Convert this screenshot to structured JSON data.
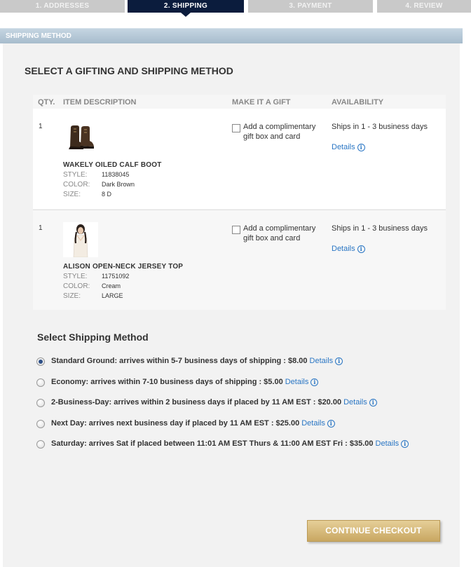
{
  "steps": [
    {
      "label": "1. ADDRESSES"
    },
    {
      "label": "2. SHIPPING"
    },
    {
      "label": "3. PAYMENT"
    },
    {
      "label": "4. REVIEW"
    }
  ],
  "section": {
    "title": "SHIPPING METHOD"
  },
  "panel": {
    "title": "SELECT A GIFTING AND SHIPPING METHOD"
  },
  "table": {
    "headers": {
      "qty": "QTY.",
      "description": "ITEM DESCRIPTION",
      "gift": "MAKE IT A GIFT",
      "availability": "AVAILABILITY"
    },
    "attr_labels": {
      "style": "STYLE:",
      "color": "COLOR:",
      "size": "SIZE:"
    },
    "items": [
      {
        "qty": "1",
        "name": "WAKELY OILED CALF BOOT",
        "style": "11838045",
        "color": "Dark Brown",
        "size": "8 D",
        "gift_text": "Add a complimentary gift box and card",
        "availability": "Ships in 1 - 3 business days",
        "details": "Details"
      },
      {
        "qty": "1",
        "name": "ALISON OPEN-NECK JERSEY TOP",
        "style": "11751092",
        "color": "Cream",
        "size": "LARGE",
        "gift_text": "Add a complimentary gift box and card",
        "availability": "Ships in 1 - 3 business days",
        "details": "Details"
      }
    ]
  },
  "shipping": {
    "title": "Select Shipping Method",
    "options": [
      {
        "label": "Standard Ground: arrives within 5-7 business days of shipping : $8.00",
        "details": "Details",
        "selected": true
      },
      {
        "label": "Economy: arrives within 7-10 business days of shipping : $5.00",
        "details": "Details",
        "selected": false
      },
      {
        "label": "2-Business-Day: arrives within 2 business days if placed by 11 AM EST : $20.00",
        "details": "Details",
        "selected": false
      },
      {
        "label": "Next Day: arrives next business day if placed by 11 AM EST : $25.00",
        "details": "Details",
        "selected": false
      },
      {
        "label": "Saturday: arrives Sat if placed between 11:01 AM EST Thurs & 11:00 AM EST Fri : $35.00",
        "details": "Details",
        "selected": false
      }
    ]
  },
  "actions": {
    "continue_label": "CONTINUE CHECKOUT"
  },
  "icons": {
    "info": "info-icon",
    "boot": "boot-thumbnail",
    "top": "top-thumbnail"
  },
  "colors": {
    "active_step": "#0b1c3d",
    "link": "#2a76c4",
    "button_gold": "#c9a762",
    "section_bar": "#a7bccd"
  }
}
